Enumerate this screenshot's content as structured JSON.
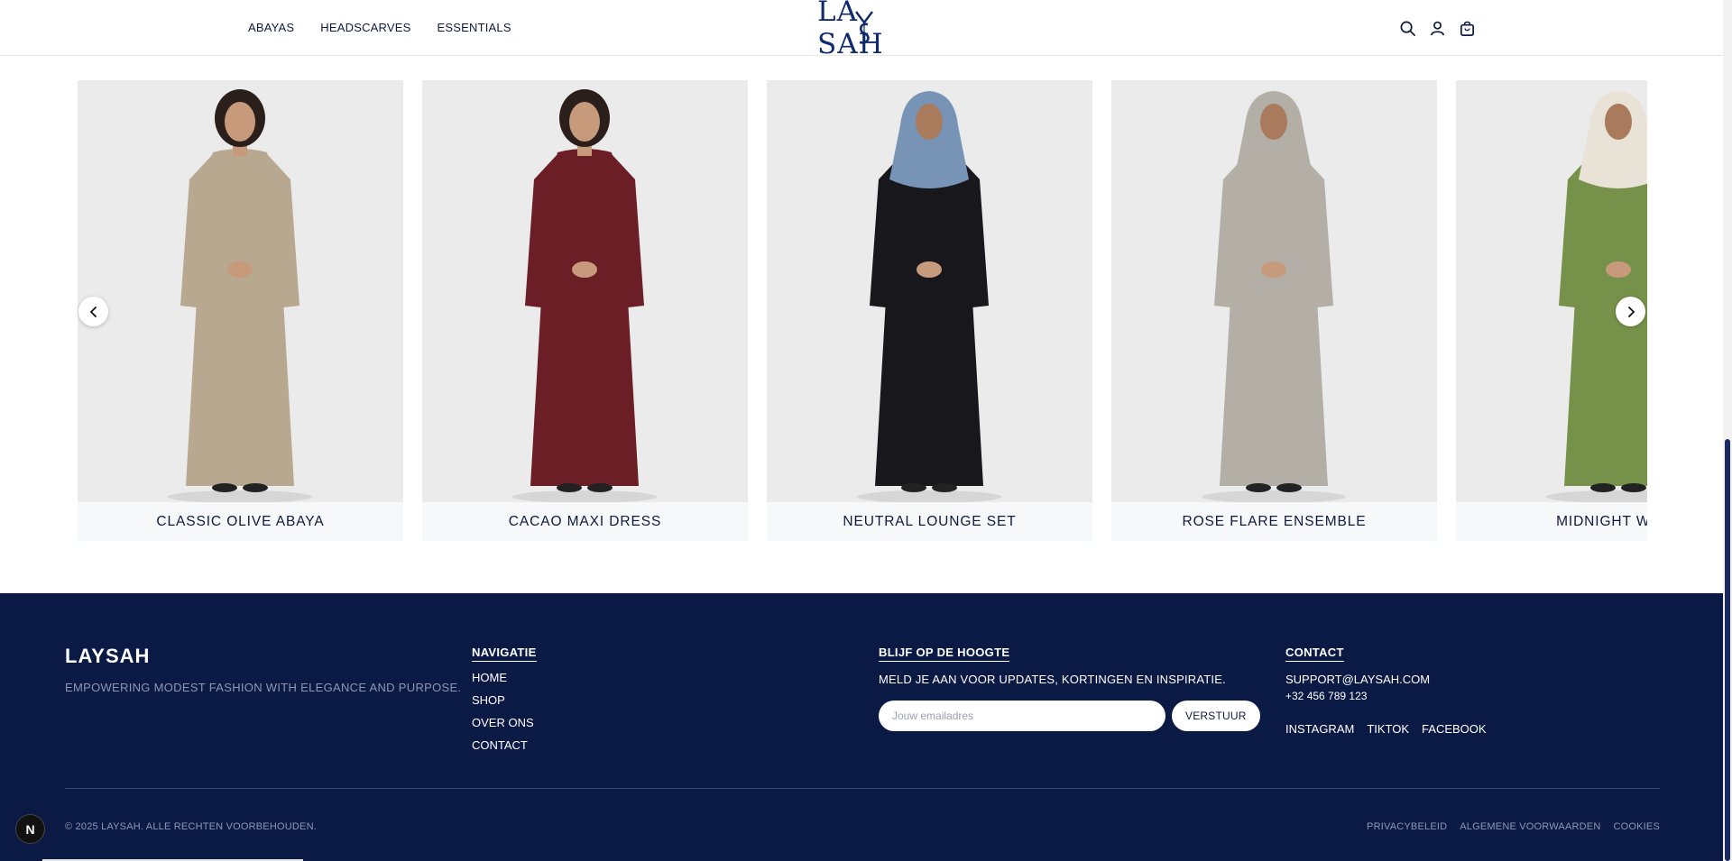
{
  "header": {
    "nav": [
      "ABAYAS",
      "HEADSCARVES",
      "ESSENTIALS"
    ],
    "logo": "LA SAH",
    "icons": [
      "search-icon",
      "account-icon",
      "cart-icon"
    ]
  },
  "carousel": {
    "products": [
      {
        "title": "CLASSIC OLIVE ABAYA",
        "garment_color": "#b9a890",
        "head": "hair"
      },
      {
        "title": "CACAO MAXI DRESS",
        "garment_color": "#6b1e26",
        "head": "hair"
      },
      {
        "title": "NEUTRAL LOUNGE SET",
        "garment_color": "#17171c",
        "head": "hijab",
        "hijab_color": "#7794b6"
      },
      {
        "title": "ROSE FLARE ENSEMBLE",
        "garment_color": "#b3afa6",
        "head": "hijab",
        "hijab_color": "#b3afa6"
      },
      {
        "title": "MIDNIGHT WRAP",
        "garment_color": "#76924a",
        "head": "hijab",
        "hijab_color": "#e8e3d6"
      }
    ],
    "prev_icon": "chevron-left-icon",
    "next_icon": "chevron-right-icon"
  },
  "footer": {
    "brand": "LAYSAH",
    "tagline": "EMPOWERING MODEST FASHION WITH ELEGANCE AND PURPOSE.",
    "nav_heading": "NAVIGATIE",
    "nav_items": [
      "HOME",
      "SHOP",
      "OVER ONS",
      "CONTACT"
    ],
    "newsletter_heading": "BLIJF OP DE HOOGTE",
    "newsletter_text": "MELD JE AAN VOOR UPDATES, KORTINGEN EN INSPIRATIE.",
    "email_placeholder": "Jouw emailadres",
    "submit_label": "VERSTUUR",
    "contact_heading": "CONTACT",
    "email": "SUPPORT@LAYSAH.COM",
    "phone": "+32 456 789 123",
    "socials": [
      "INSTAGRAM",
      "TIKTOK",
      "FACEBOOK"
    ],
    "copyright": "© 2025 LAYSAH. ALLE RECHTEN VOORBEHOUDEN.",
    "legal": [
      "PRIVACYBELEID",
      "ALGEMENE VOORWAARDEN",
      "COOKIES"
    ]
  },
  "badge": "N",
  "colors": {
    "navy": "#0b1a45",
    "logo_blue": "#0f2b6b",
    "card_bg": "#ebebeb"
  }
}
